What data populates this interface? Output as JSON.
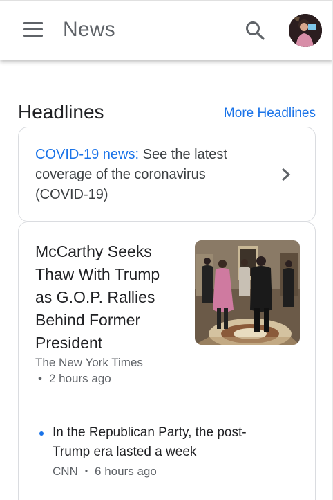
{
  "appbar": {
    "title": "News",
    "menu_icon": "hamburger-menu-icon",
    "search_icon": "search-icon",
    "avatar_icon": "user-avatar"
  },
  "headlines": {
    "title": "Headlines",
    "more_link": "More Headlines"
  },
  "covid_card": {
    "link_text": "COVID-19 news:",
    "text": " See the latest coverage of the coronavirus (COVID-19)",
    "chevron_icon": "chevron-right-icon"
  },
  "top_story": {
    "title": "McCarthy Seeks Thaw With Trump as G.O.P. Rallies Behind Former President",
    "source": "The New York Times",
    "time": "2 hours ago"
  },
  "related_story": {
    "title": "In the Republican Party, the post-Trump era lasted a week",
    "source": "CNN",
    "time": "6 hours ago"
  },
  "colors": {
    "accent": "#1a73e8",
    "text": "#202124",
    "secondary": "#5f6368",
    "border": "#dadce0"
  }
}
